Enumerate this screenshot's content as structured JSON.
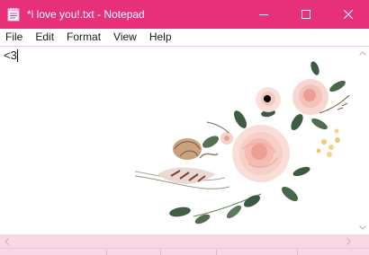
{
  "window": {
    "title": "*i love you!.txt - Notepad",
    "icon": "notepad-icon",
    "controls": [
      "minimize-icon",
      "maximize-icon",
      "close-icon"
    ]
  },
  "menu": {
    "items": [
      {
        "label": "File"
      },
      {
        "label": "Edit"
      },
      {
        "label": "Format"
      },
      {
        "label": "View"
      },
      {
        "label": "Help"
      }
    ]
  },
  "editor": {
    "content": "<3",
    "background_image": "watercolor-roses-illustration"
  },
  "scrollbars": {
    "up_icon": "chevron-up-icon",
    "down_icon": "chevron-down-icon",
    "left_icon": "chevron-left-icon",
    "right_icon": "chevron-right-icon"
  },
  "colors": {
    "titlebar": "#e6317a",
    "scrollbar": "#f9d8e6",
    "accent": "#e6317a"
  }
}
